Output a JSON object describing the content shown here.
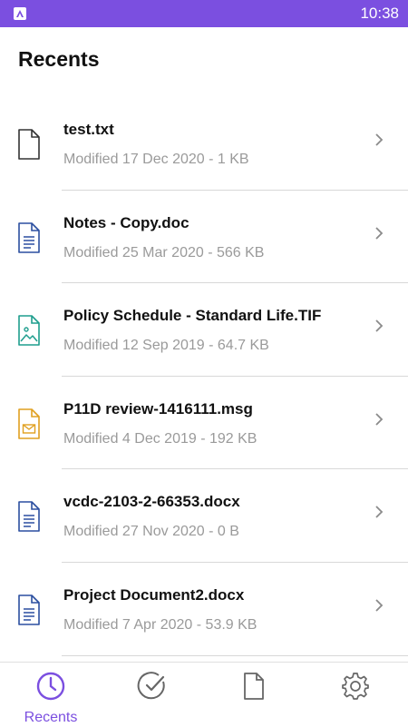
{
  "status_bar": {
    "time": "10:38",
    "app_icon": "app-logo-icon",
    "color": "#7b4fe0"
  },
  "header": {
    "title": "Recents"
  },
  "files": [
    {
      "name": "test.txt",
      "meta": "Modified 17 Dec 2020 - 1 KB",
      "icon": "text-file-icon",
      "icon_color": "#333333"
    },
    {
      "name": "Notes - Copy.doc",
      "meta": "Modified 25 Mar 2020 - 566 KB",
      "icon": "document-file-icon",
      "icon_color": "#2b4fa0"
    },
    {
      "name": "Policy Schedule - Standard Life.TIF",
      "meta": "Modified 12 Sep 2019 - 64.7 KB",
      "icon": "image-file-icon",
      "icon_color": "#1f9e8e"
    },
    {
      "name": "P11D review-1416111.msg",
      "meta": "Modified 4 Dec 2019 - 192 KB",
      "icon": "mail-file-icon",
      "icon_color": "#e0a020"
    },
    {
      "name": "vcdc-2103-2-66353.docx",
      "meta": "Modified 27 Nov 2020 - 0 B",
      "icon": "document-file-icon",
      "icon_color": "#2b4fa0"
    },
    {
      "name": "Project Document2.docx",
      "meta": "Modified 7 Apr 2020 - 53.9 KB",
      "icon": "document-file-icon",
      "icon_color": "#2b4fa0"
    }
  ],
  "bottom_nav": {
    "items": [
      {
        "label": "Recents",
        "icon": "clock-icon",
        "active": true
      },
      {
        "label": "",
        "icon": "check-circle-icon",
        "active": false
      },
      {
        "label": "",
        "icon": "file-icon",
        "active": false
      },
      {
        "label": "",
        "icon": "gear-icon",
        "active": false
      }
    ],
    "accent": "#7b4fe0"
  }
}
